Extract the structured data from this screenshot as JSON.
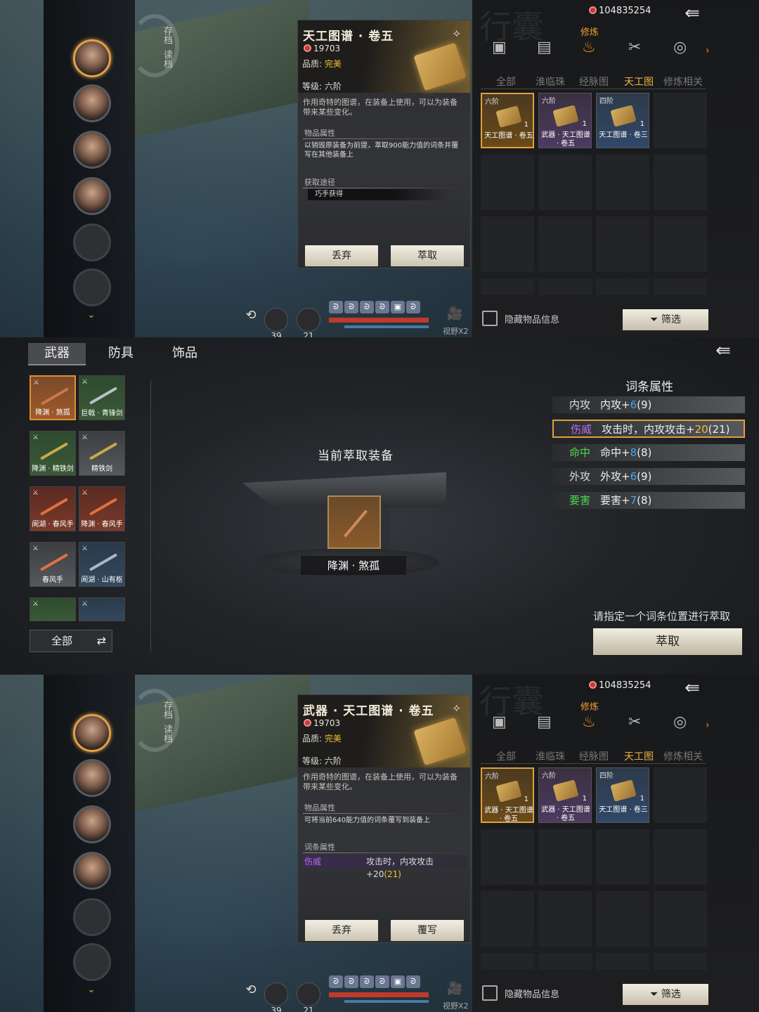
{
  "panel1": {
    "save_labels": [
      "存档",
      "读档"
    ],
    "bottom": {
      "count1": "39",
      "count2": "21",
      "view": "视野X2"
    },
    "detail": {
      "title": "天工图谱 · 卷五",
      "price": "19703",
      "quality_label": "品质: ",
      "quality": "完美",
      "grade": "等级: 六阶",
      "desc": "作用奇特的图谱，在装备上使用，可以为装备带来某些变化。",
      "sec1": "物品属性",
      "attr1": "以销毁原装备为前提，萃取900能力值的词条并覆写在其他装备上",
      "sec2": "获取途径",
      "path": "巧手获得",
      "btn_left": "丢弃",
      "btn_right": "萃取"
    },
    "bag": {
      "big_title": "行囊",
      "money": "104835254",
      "category": "修炼",
      "tabs": [
        "全部",
        "淮临珠",
        "经脉图",
        "天工图",
        "修炼相关"
      ],
      "active_tab": "天工图",
      "hide_label": "隐藏物品信息",
      "filter": "筛选",
      "items": [
        {
          "tier": "六阶",
          "count": "1",
          "name": "天工图谱 · 卷五"
        },
        {
          "tier": "六阶",
          "count": "1",
          "name": "武器 · 天工图谱 · 卷五"
        },
        {
          "tier": "四阶",
          "count": "1",
          "name": "天工图谱 · 卷三"
        }
      ]
    }
  },
  "panel2": {
    "tabs": [
      "武器",
      "防具",
      "饰品"
    ],
    "weapons": [
      "降渊 · 煞孤",
      "巨戟 · 青锋剑",
      "降渊 · 精铁剑",
      "精铁剑",
      "阆湖 · 春风手",
      "降渊 · 春风手",
      "春风手",
      "阆湖 · 山有枢"
    ],
    "all_label": "全部",
    "current_label": "当前萃取装备",
    "current_item": "降渊 · 煞孤",
    "attr_head": "词条属性",
    "attrs": [
      {
        "key": "内攻",
        "val": "内攻+",
        "num": "6",
        "extra": "(9)"
      },
      {
        "key": "伤威",
        "val": "攻击时，内攻攻击+",
        "num": "20",
        "extra": "(21)"
      },
      {
        "key": "命中",
        "val": "命中+",
        "num": "8",
        "extra": "(8)"
      },
      {
        "key": "外攻",
        "val": "外攻+",
        "num": "6",
        "extra": "(9)"
      },
      {
        "key": "要害",
        "val": "要害+",
        "num": "7",
        "extra": "(8)"
      }
    ],
    "hint": "请指定一个词条位置进行萃取",
    "extract": "萃取"
  },
  "panel3": {
    "save_labels": [
      "存档",
      "读档"
    ],
    "bottom": {
      "count1": "39",
      "count2": "21",
      "view": "视野X2"
    },
    "detail": {
      "title": "武器 · 天工图谱 · 卷五",
      "price": "19703",
      "quality_label": "品质: ",
      "quality": "完美",
      "grade": "等级: 六阶",
      "desc": "作用奇特的图谱，在装备上使用，可以为装备带来某些变化。",
      "sec1": "物品属性",
      "attr1": "可将当前640能力值的词条覆写到装备上",
      "sec2": "词条属性",
      "word_name": "伤威",
      "word_val": "攻击时，内攻攻击+20",
      "word_extra": "(21)",
      "btn_left": "丢弃",
      "btn_right": "覆写"
    },
    "bag": {
      "big_title": "行囊",
      "money": "104835254",
      "category": "修炼",
      "tabs": [
        "全部",
        "淮临珠",
        "经脉图",
        "天工图",
        "修炼相关"
      ],
      "hide_label": "隐藏物品信息",
      "filter": "筛选",
      "items": [
        {
          "tier": "六阶",
          "count": "1",
          "name": "武器 · 天工图谱 · 卷五"
        },
        {
          "tier": "六阶",
          "count": "1",
          "name": "武器 · 天工图谱 · 卷五"
        },
        {
          "tier": "四阶",
          "count": "1",
          "name": "天工图谱 · 卷三"
        }
      ]
    }
  }
}
